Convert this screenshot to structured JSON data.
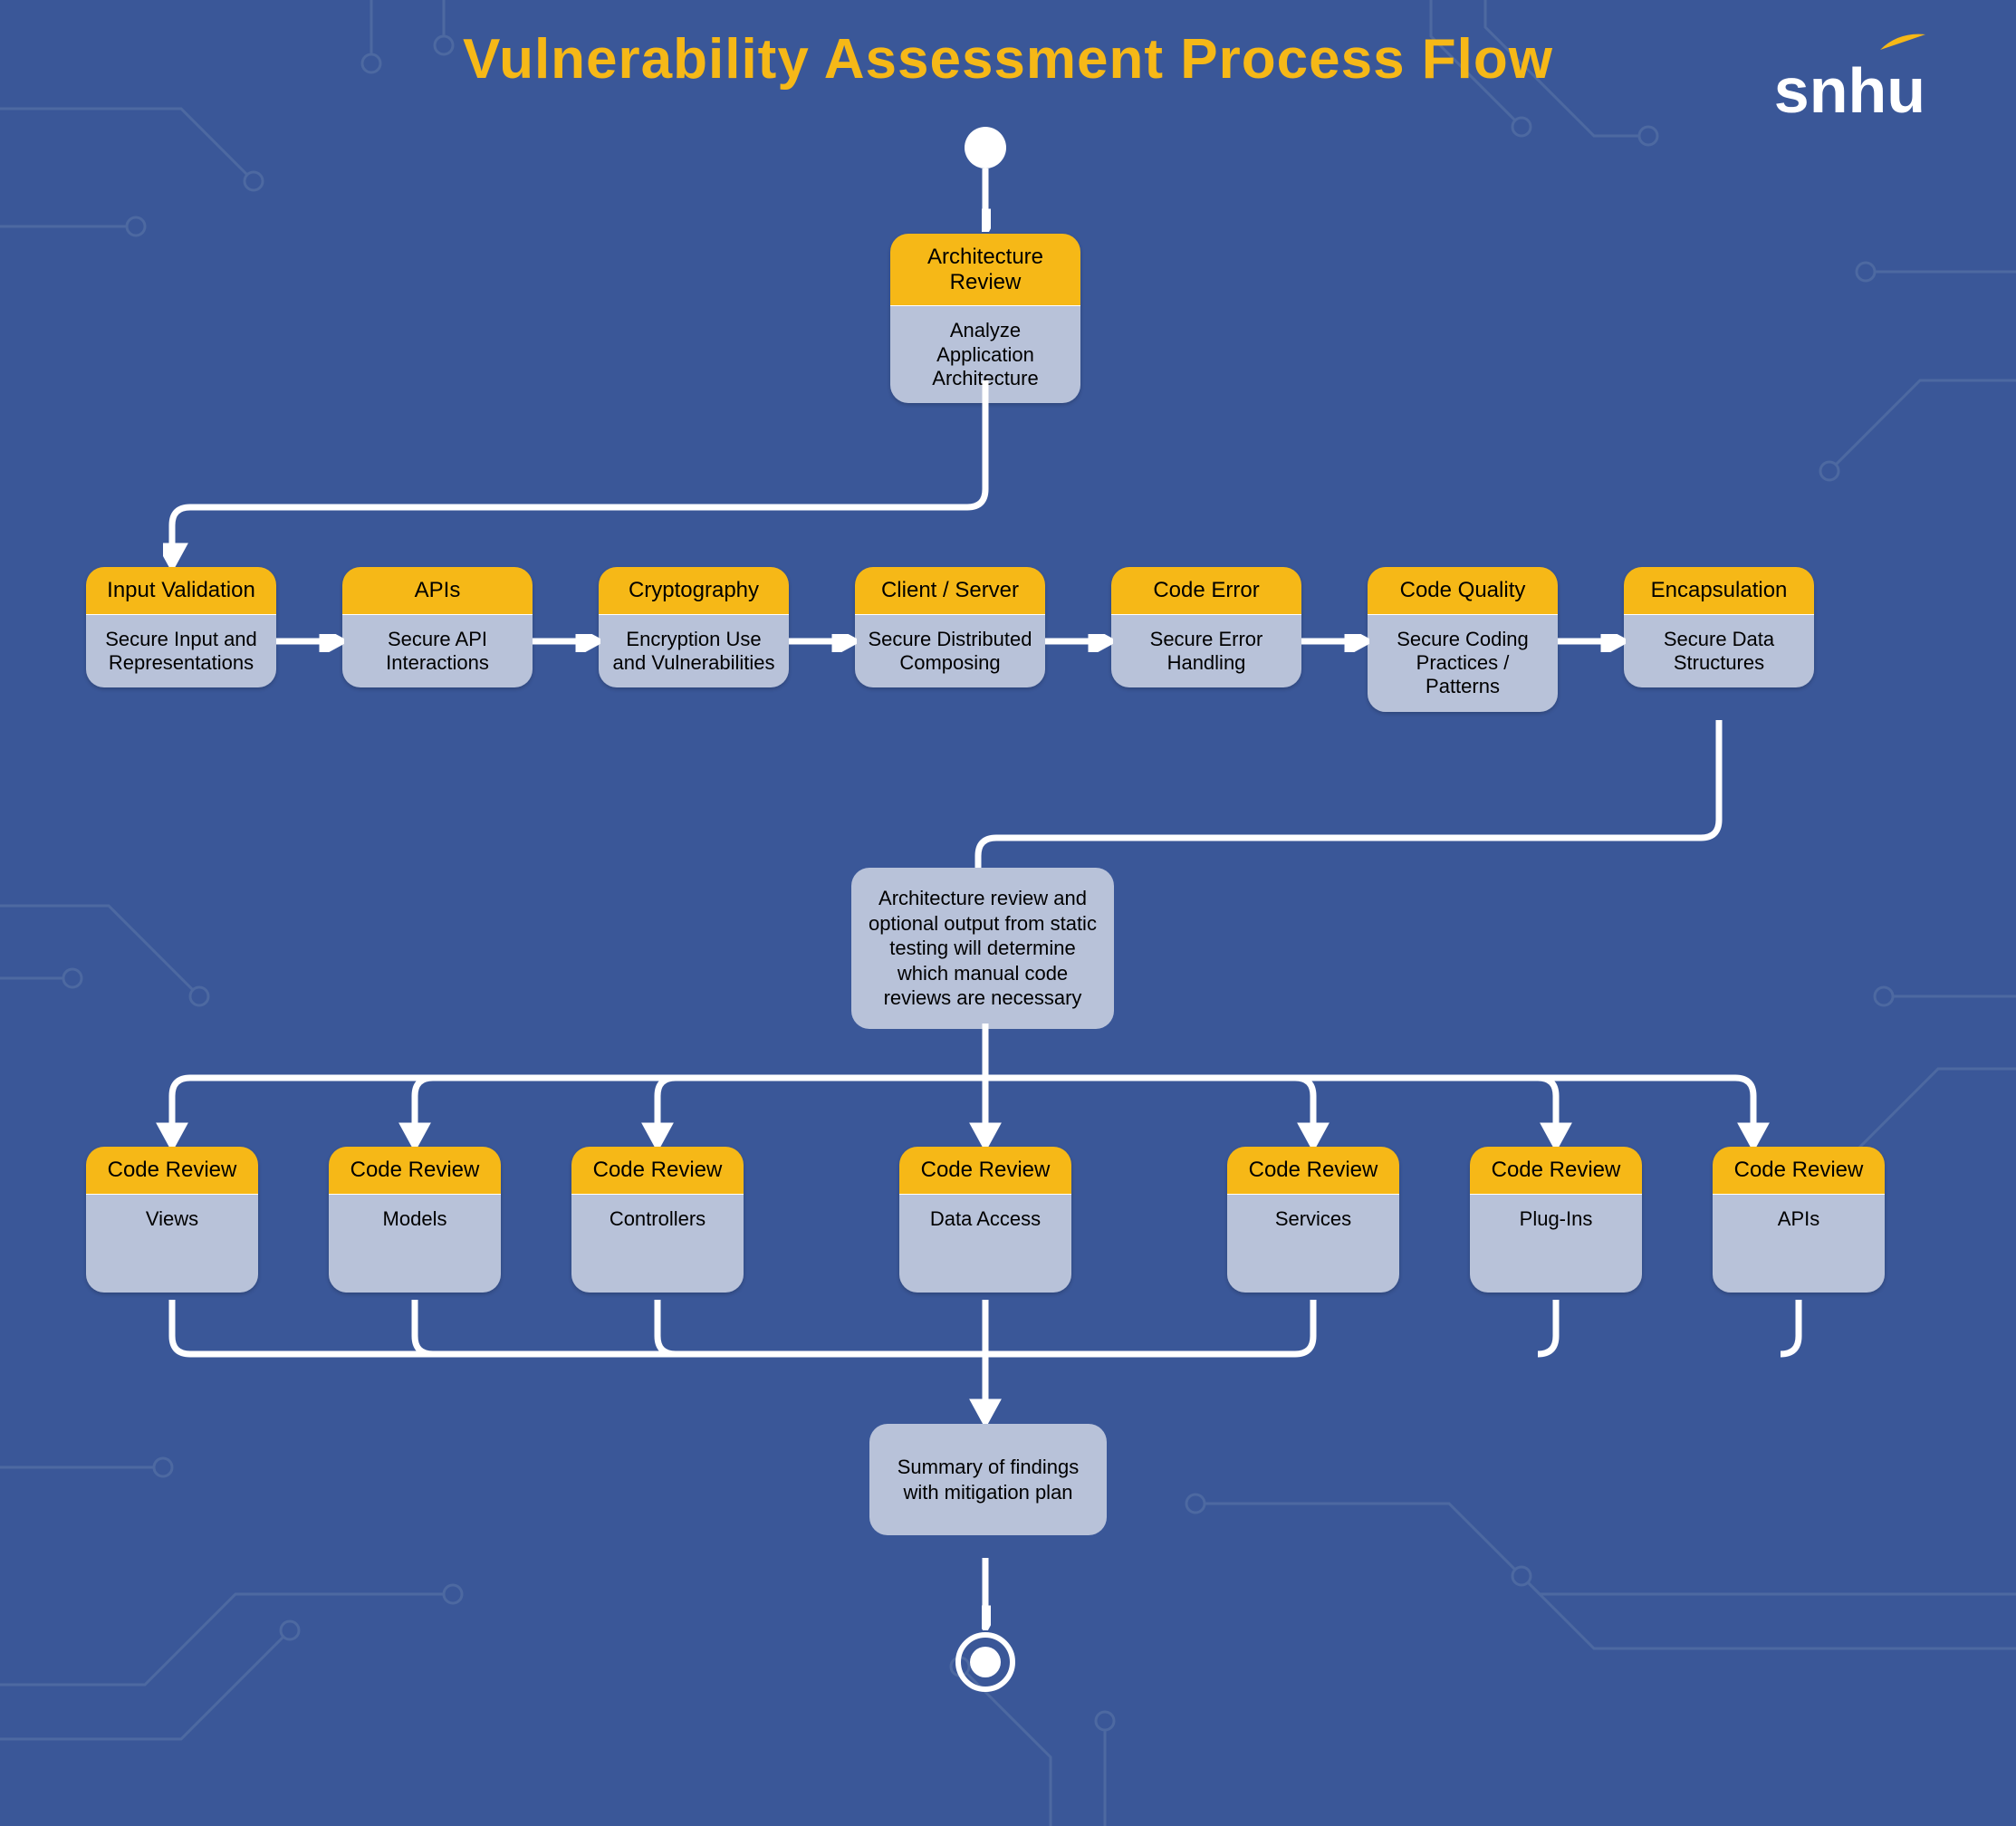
{
  "title": "Vulnerability Assessment Process Flow",
  "logo": "snhu",
  "arch": {
    "hdr": "Architecture Review",
    "body": "Analyze Application Architecture"
  },
  "row1": [
    {
      "hdr": "Input Validation",
      "body": "Secure Input and Representations"
    },
    {
      "hdr": "APIs",
      "body": "Secure API Interactions"
    },
    {
      "hdr": "Cryptography",
      "body": "Encryption Use and Vulnerabilities"
    },
    {
      "hdr": "Client / Server",
      "body": "Secure Distributed Composing"
    },
    {
      "hdr": "Code Error",
      "body": "Secure Error Handling"
    },
    {
      "hdr": "Code Quality",
      "body": "Secure Coding Practices / Patterns"
    },
    {
      "hdr": "Encapsulation",
      "body": "Secure Data Structures"
    }
  ],
  "decision": "Architecture review and optional output from static testing will determine which manual code reviews are necessary",
  "row2": [
    {
      "hdr": "Code Review",
      "body": "Views"
    },
    {
      "hdr": "Code Review",
      "body": "Models"
    },
    {
      "hdr": "Code Review",
      "body": "Controllers"
    },
    {
      "hdr": "Code Review",
      "body": "Data Access"
    },
    {
      "hdr": "Code Review",
      "body": "Services"
    },
    {
      "hdr": "Code Review",
      "body": "Plug-Ins"
    },
    {
      "hdr": "Code Review",
      "body": "APIs"
    }
  ],
  "summary": "Summary of findings with mitigation plan"
}
